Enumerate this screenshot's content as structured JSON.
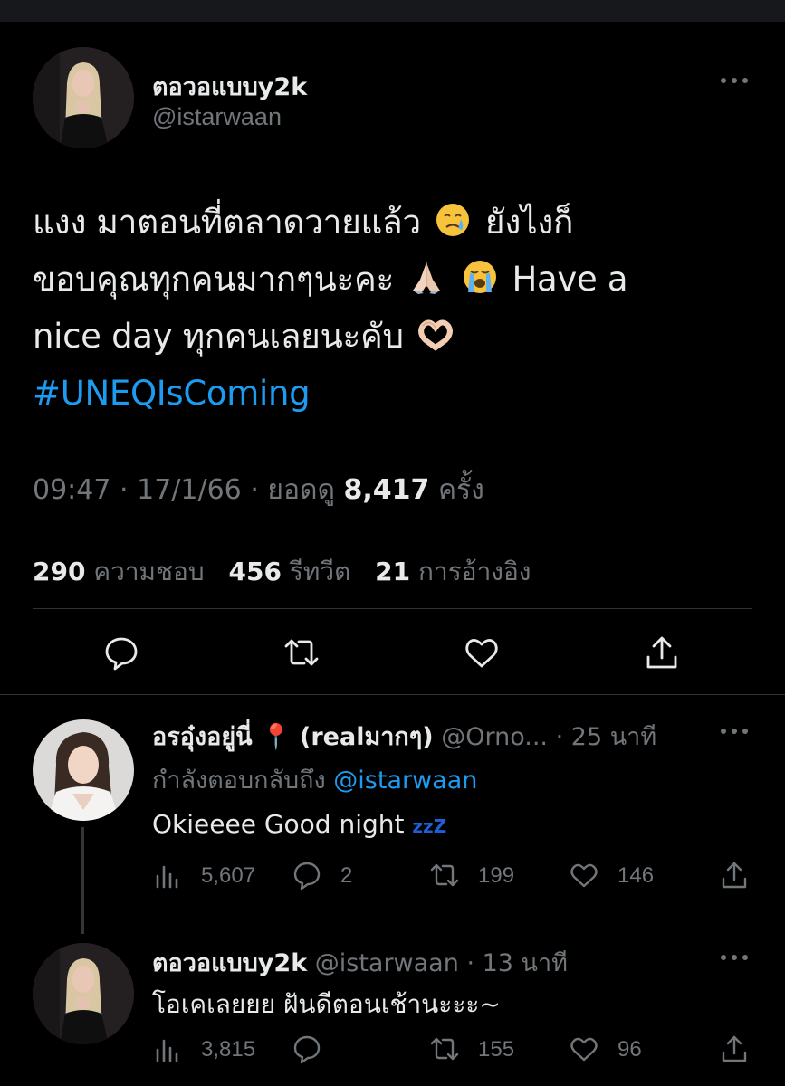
{
  "tweet": {
    "author_name": "ตอวอแบบy2k",
    "author_handle": "@istarwaan",
    "line1_a": "แงง มาตอนที่ตลาดวายแล้ว",
    "line1_b": "ยังไงก็",
    "line2_a": "ขอบคุณทุกคนมากๆนะคะ",
    "line2_b": "Have a",
    "line3_a": "nice day ทุกคนเลยนะคับ",
    "hashtag": "#UNEQIsComing",
    "time": "09:47",
    "date": "17/1/66",
    "views_label": "ยอดดู",
    "views_count": "8,417",
    "views_unit": "ครั้ง",
    "likes_count": "290",
    "likes_label": "ความชอบ",
    "retweets_count": "456",
    "retweets_label": "รีทวีต",
    "quotes_count": "21",
    "quotes_label": "การอ้างอิง",
    "emoji": [
      "crying-face",
      "folded-hands",
      "loudly-crying-face",
      "heart-hands"
    ]
  },
  "replies": [
    {
      "name": "อรอุ๋งอยู่นี่ 📍 (realมากๆ)",
      "handle": "@Orno...",
      "time": "· 25 นาที",
      "replying_to_label": "กำลังตอบกลับถึง",
      "replying_to_handle": "@istarwaan",
      "text": "Okieeee Good night",
      "text_suffix": "zzZ",
      "views": "5,607",
      "replies": "2",
      "retweets": "199",
      "likes": "146"
    },
    {
      "name": "ตอวอแบบy2k",
      "handle": "@istarwaan",
      "time": "· 13 นาที",
      "text": "โอเคเลยยย ฝันดีตอนเช้านะะะ~",
      "views": "3,815",
      "retweets": "155",
      "likes": "96"
    }
  ],
  "colors": {
    "background": "#000000",
    "text": "#e7e9ea",
    "muted": "#71767b",
    "accent": "#1d9bf0",
    "divider": "#2f3336"
  }
}
